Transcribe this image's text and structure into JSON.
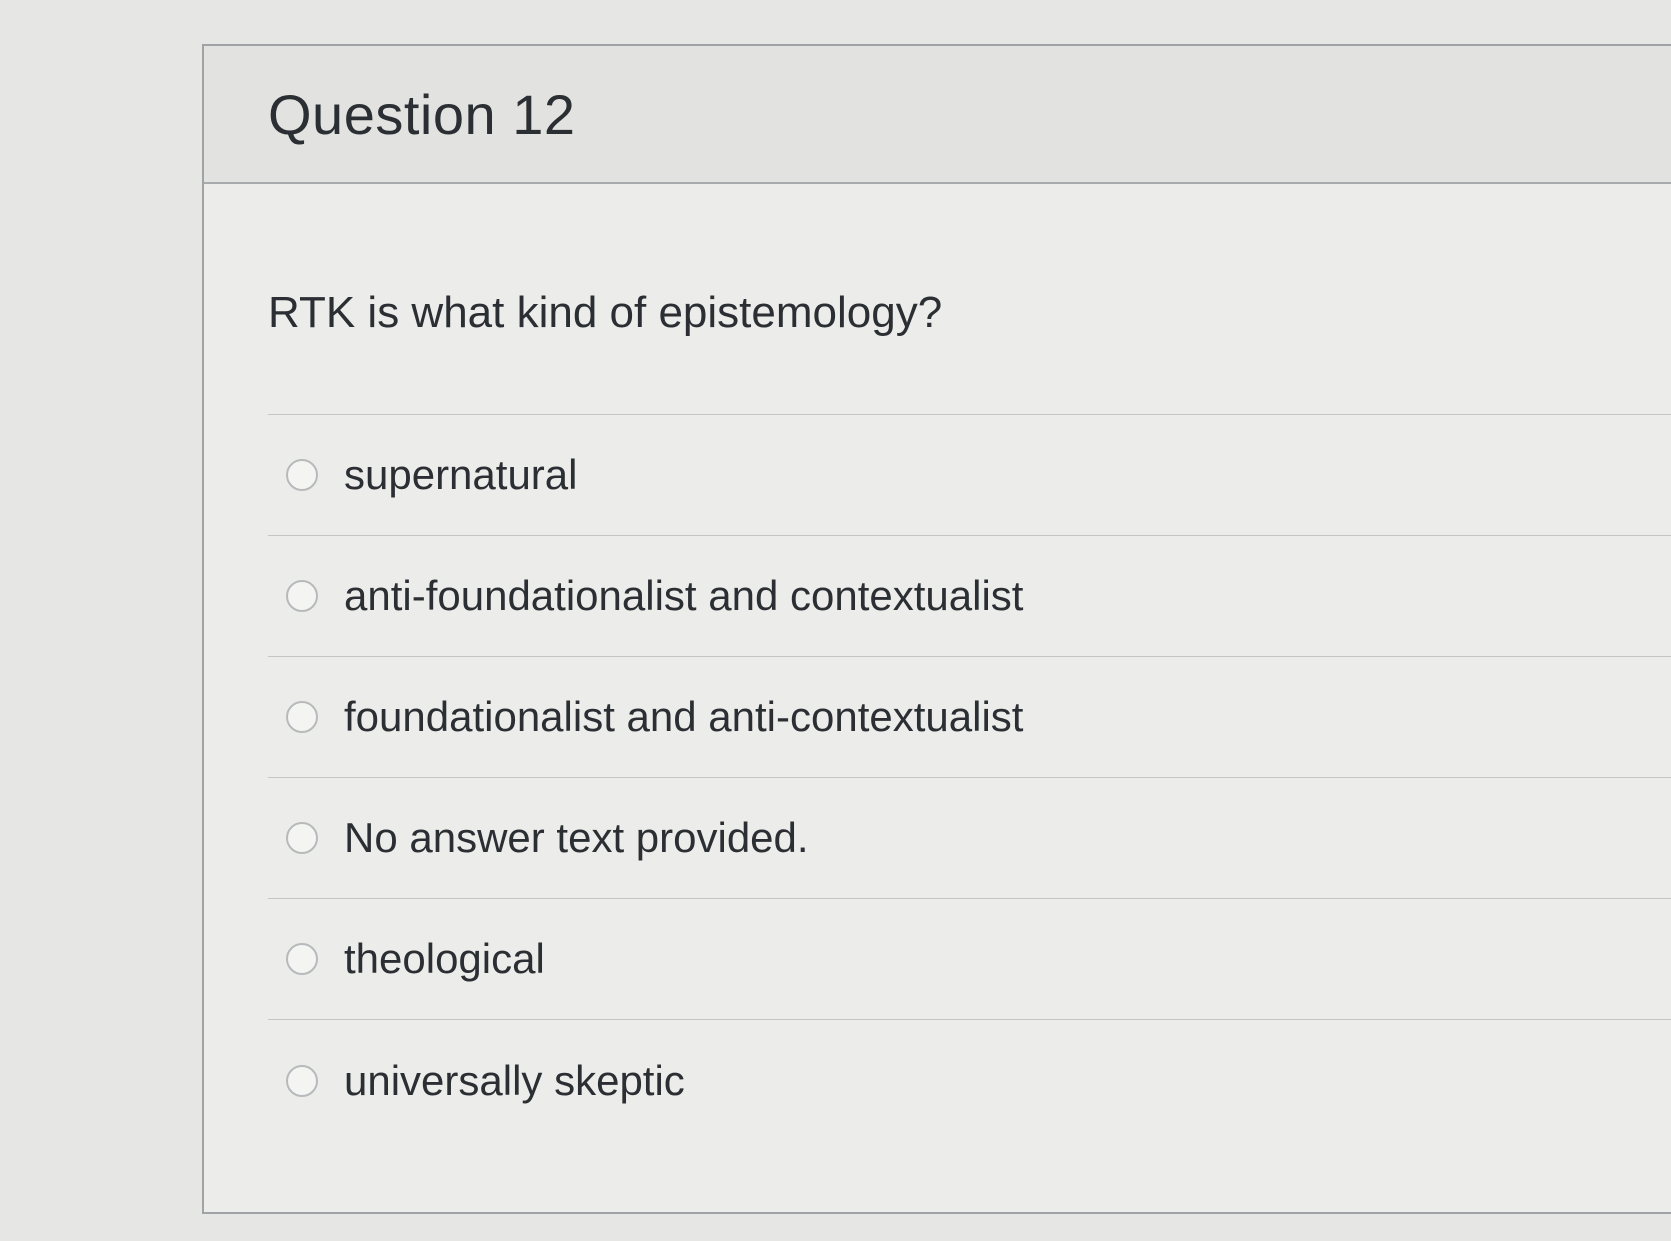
{
  "question": {
    "title": "Question 12",
    "text": "RTK is what kind of epistemology?"
  },
  "answers": [
    {
      "label": "supernatural"
    },
    {
      "label": "anti-foundationalist and contextualist"
    },
    {
      "label": "foundationalist and anti-contextualist"
    },
    {
      "label": "No answer text provided."
    },
    {
      "label": "theological"
    },
    {
      "label": "universally skeptic"
    }
  ]
}
